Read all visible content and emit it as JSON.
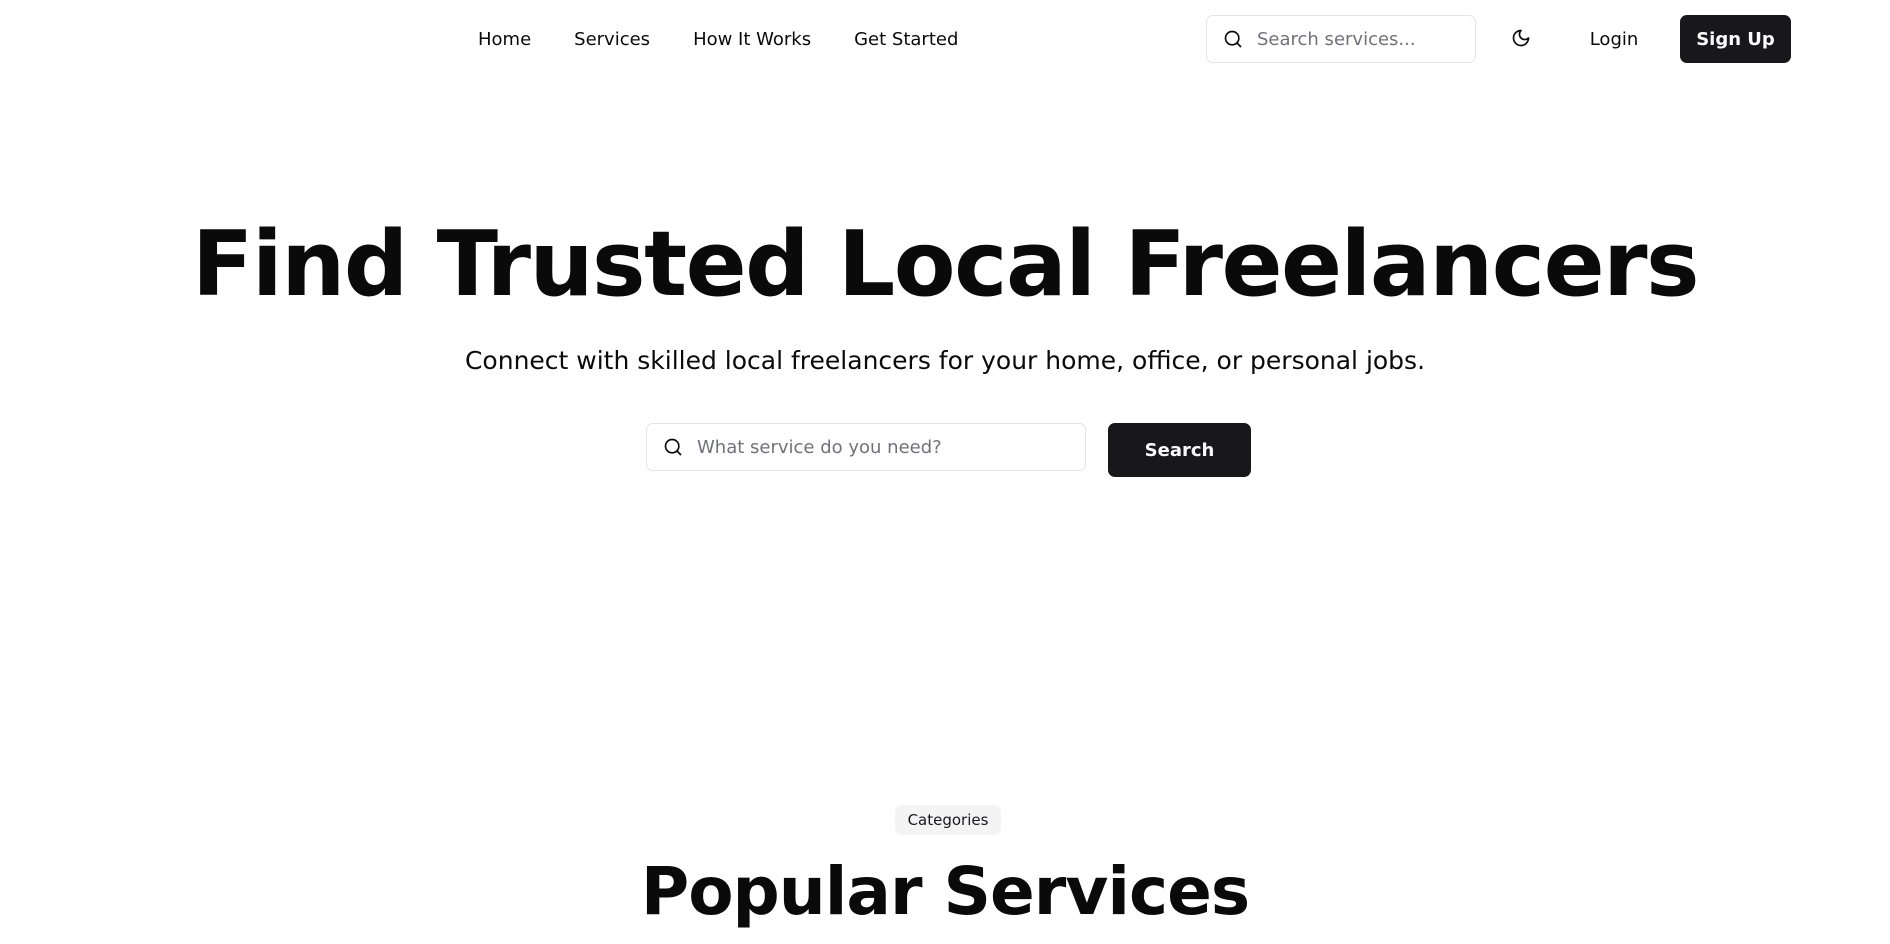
{
  "header": {
    "nav": [
      "Home",
      "Services",
      "How It Works",
      "Get Started"
    ],
    "search": {
      "placeholder": "Search services...",
      "value": "",
      "icon": "search-icon"
    },
    "theme_toggle": {
      "icon": "moon-icon"
    },
    "login_label": "Login",
    "signup_label": "Sign Up"
  },
  "hero": {
    "title": "Find Trusted Local Freelancers",
    "subtitle": "Connect with skilled local freelancers for your home, office, or personal jobs.",
    "search": {
      "placeholder": "What service do you need?",
      "value": "",
      "icon": "search-icon"
    },
    "search_button_label": "Search"
  },
  "categories": {
    "badge": "Categories",
    "title": "Popular Services"
  },
  "colors": {
    "primary": "#18181b",
    "primary_text": "#fafafa",
    "text": "#0a0a0a",
    "muted_text": "#71717a",
    "border": "#e4e4e7",
    "badge_bg": "#f4f4f5",
    "background": "#ffffff"
  }
}
